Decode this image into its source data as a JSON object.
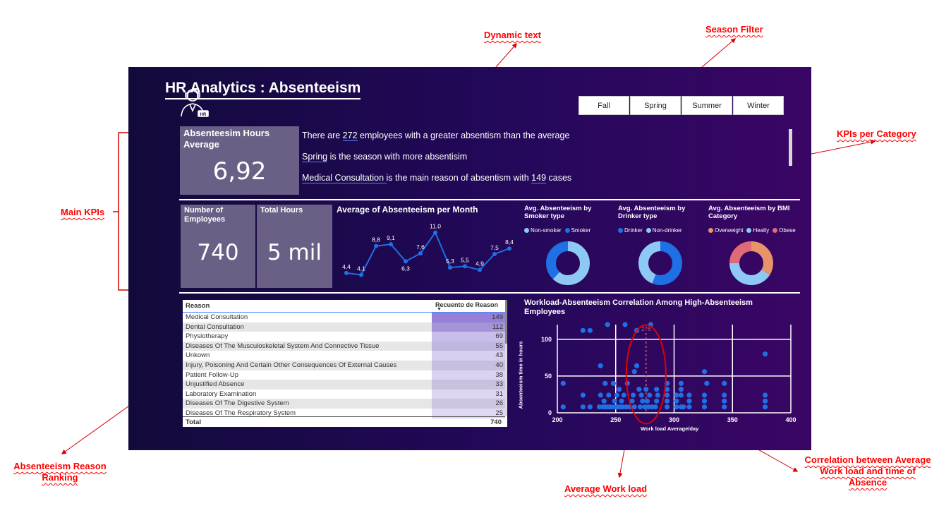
{
  "annotations": {
    "dynamic_text": "Dynamic text",
    "season_filter": "Season Filter",
    "kpis_per_category": "KPIs per Category",
    "main_kpis": "Main KPIs",
    "reason_ranking": "Absenteeism Reason Ranking",
    "average_work_load": "Average Work load",
    "correlation": "Correlation between Average Work load and time of Absence"
  },
  "dashboard": {
    "title": "HR Analytics : Absenteeism",
    "seasons": [
      "Fall",
      "Spring",
      "Summer",
      "Winter"
    ],
    "kpis": {
      "hours_avg_label": "Absenteesim Hours Average",
      "hours_avg_value": "6,92",
      "employees_label": "Number of Employees",
      "employees_value": "740",
      "total_hours_label": "Total Hours",
      "total_hours_value": "5 mil"
    },
    "dynamic_text": {
      "line1_pre": "There are ",
      "line1_num": "272",
      "line1_post": " employees with a greater absentism than the average",
      "line2_season": "Spring",
      "line2_post": " is the season with more absentisim",
      "line3_reason": "Medical Consultation ",
      "line3_mid": " is the main reason of absentism with ",
      "line3_num": "149",
      "line3_post": " cases"
    },
    "colors": {
      "background_left": "#130a3c",
      "background_right": "#3a0664",
      "accent_blue": "#1f6fe5",
      "light_blue": "#8ec8f4",
      "orange": "#e8936a",
      "rose": "#e06a78",
      "annotation_red": "#ff0000",
      "kpi_box": "#6a6086"
    },
    "donuts": [
      {
        "title": "Avg. Absenteeism by Smoker type",
        "legend": [
          {
            "label": "Non-smoker",
            "color": "#8ec8f4"
          },
          {
            "label": "Smoker",
            "color": "#1f6fe5"
          }
        ]
      },
      {
        "title": "Avg. Absenteeism by Drinker type",
        "legend": [
          {
            "label": "Drinker",
            "color": "#1f6fe5"
          },
          {
            "label": "Non-drinker",
            "color": "#8ec8f4"
          }
        ]
      },
      {
        "title": "Avg. Absenteeism by BMI Category",
        "legend": [
          {
            "label": "Overweight",
            "color": "#e8936a"
          },
          {
            "label": "Healty",
            "color": "#8ec8f4"
          },
          {
            "label": "Obese",
            "color": "#e06a78"
          }
        ]
      }
    ],
    "table": {
      "col_reason": "Reason",
      "col_count": "Recuento de Reason",
      "rows": [
        {
          "reason": "Medical Consultation",
          "count": "149"
        },
        {
          "reason": "Dental Consultation",
          "count": "112"
        },
        {
          "reason": "Physiotherapy",
          "count": "69"
        },
        {
          "reason": "Diseases Of The Musculoskeletal System And Connective Tissue",
          "count": "55"
        },
        {
          "reason": "Unkown",
          "count": "43"
        },
        {
          "reason": "Injury, Poisoning And Certain Other Consequences Of External Causes",
          "count": "40"
        },
        {
          "reason": "Patient Follow-Up",
          "count": "38"
        },
        {
          "reason": "Unjustified Absence",
          "count": "33"
        },
        {
          "reason": "Laboratory Examination",
          "count": "31"
        },
        {
          "reason": "Diseases Of The Digestive System",
          "count": "26"
        },
        {
          "reason": "Diseases Of The Respiratory System",
          "count": "25"
        }
      ],
      "total_label": "Total",
      "total_value": "740"
    }
  },
  "chart_data": [
    {
      "type": "line",
      "title": "Average of Absenteeism per Month",
      "x": [
        1,
        2,
        3,
        4,
        5,
        6,
        7,
        8,
        9,
        10,
        11,
        12
      ],
      "values": [
        4.4,
        4.1,
        8.8,
        9.1,
        6.3,
        7.6,
        11.0,
        5.3,
        5.5,
        4.9,
        7.5,
        8.4
      ],
      "labels": [
        "4,4",
        "4,1",
        "8,8",
        "9,1",
        "6,3",
        "7,6",
        "11,0",
        "5,3",
        "5,5",
        "4,9",
        "7,5",
        "8,4"
      ],
      "color": "#1f6fe5"
    },
    {
      "type": "pie",
      "title": "Avg. Absenteeism by Smoker type",
      "series": [
        {
          "name": "Non-smoker",
          "value": 0.62
        },
        {
          "name": "Smoker",
          "value": 0.38
        }
      ]
    },
    {
      "type": "pie",
      "title": "Avg. Absenteeism by Drinker type",
      "series": [
        {
          "name": "Drinker",
          "value": 0.56
        },
        {
          "name": "Non-drinker",
          "value": 0.44
        }
      ]
    },
    {
      "type": "pie",
      "title": "Avg. Absenteeism by BMI Category",
      "series": [
        {
          "name": "Overweight",
          "value": 0.34
        },
        {
          "name": "Healty",
          "value": 0.41
        },
        {
          "name": "Obese",
          "value": 0.25
        }
      ]
    },
    {
      "type": "scatter",
      "title": "Workload-Absenteeism Correlation Among High-Absenteeism Employees",
      "xlabel": "Work load Average/day",
      "ylabel": "Absenteeism time in hours",
      "xlim": [
        200,
        400
      ],
      "ylim": [
        0,
        120
      ],
      "xticks": [
        "200",
        "250",
        "300",
        "350",
        "400"
      ],
      "yticks": [
        "0",
        "50",
        "100"
      ],
      "reference_line": {
        "x": 276,
        "label": "276"
      },
      "points": [
        [
          205,
          40
        ],
        [
          205,
          8
        ],
        [
          222,
          112
        ],
        [
          222,
          24
        ],
        [
          222,
          8
        ],
        [
          228,
          112
        ],
        [
          228,
          8
        ],
        [
          236,
          8
        ],
        [
          237,
          64
        ],
        [
          237,
          24
        ],
        [
          239,
          8
        ],
        [
          240,
          16
        ],
        [
          241,
          8
        ],
        [
          241,
          40
        ],
        [
          243,
          8
        ],
        [
          243,
          120
        ],
        [
          244,
          24
        ],
        [
          245,
          8
        ],
        [
          247,
          8
        ],
        [
          248,
          40
        ],
        [
          249,
          16
        ],
        [
          250,
          8
        ],
        [
          251,
          24
        ],
        [
          252,
          8
        ],
        [
          253,
          32
        ],
        [
          254,
          8
        ],
        [
          255,
          16
        ],
        [
          256,
          8
        ],
        [
          257,
          24
        ],
        [
          258,
          120
        ],
        [
          259,
          8
        ],
        [
          260,
          40
        ],
        [
          262,
          8
        ],
        [
          264,
          16
        ],
        [
          265,
          24
        ],
        [
          266,
          56
        ],
        [
          266,
          8
        ],
        [
          268,
          64
        ],
        [
          268,
          112
        ],
        [
          270,
          32
        ],
        [
          271,
          8
        ],
        [
          272,
          24
        ],
        [
          273,
          16
        ],
        [
          275,
          8
        ],
        [
          276,
          32
        ],
        [
          277,
          16
        ],
        [
          278,
          8
        ],
        [
          279,
          24
        ],
        [
          280,
          120
        ],
        [
          281,
          8
        ],
        [
          284,
          8
        ],
        [
          285,
          32
        ],
        [
          285,
          16
        ],
        [
          286,
          24
        ],
        [
          294,
          40
        ],
        [
          294,
          32
        ],
        [
          294,
          24
        ],
        [
          294,
          16
        ],
        [
          294,
          8
        ],
        [
          302,
          8
        ],
        [
          302,
          24
        ],
        [
          302,
          16
        ],
        [
          306,
          8
        ],
        [
          306,
          40
        ],
        [
          306,
          32
        ],
        [
          306,
          24
        ],
        [
          308,
          8
        ],
        [
          313,
          8
        ],
        [
          313,
          16
        ],
        [
          313,
          24
        ],
        [
          326,
          8
        ],
        [
          326,
          16
        ],
        [
          326,
          24
        ],
        [
          326,
          56
        ],
        [
          328,
          40
        ],
        [
          343,
          8
        ],
        [
          343,
          16
        ],
        [
          343,
          24
        ],
        [
          343,
          40
        ],
        [
          378,
          8
        ],
        [
          378,
          24
        ],
        [
          378,
          16
        ],
        [
          378,
          80
        ]
      ]
    }
  ]
}
